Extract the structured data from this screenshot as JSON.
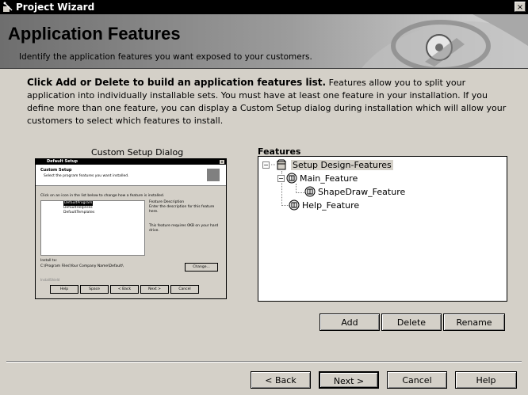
{
  "window": {
    "title": "Project Wizard",
    "close_glyph": "×"
  },
  "banner": {
    "title": "Application Features",
    "subtitle": "Identify the application features you want exposed to your customers."
  },
  "description": {
    "bold": "Click Add or Delete to build an application features list.",
    "text": " Features allow you to split your application into individually installable sets. You must have at least one feature in your installation. If you define more than one feature, you can display a Custom Setup dialog during installation which will allow your customers to select which features to install."
  },
  "custom_setup": {
    "label": "Custom Setup Dialog",
    "preview": {
      "title": "Default Setup",
      "close_glyph": "×",
      "header_title": "Custom Setup",
      "header_sub": "Select the program features you want installed.",
      "instruction": "Click on an icon in the list below to change how a feature is installed.",
      "items": [
        "DefaultProgram",
        "DefaultHelpFiles",
        "DefaultTemplates"
      ],
      "feature_desc_title": "Feature Description",
      "feature_desc": "Enter the description for this feature here.",
      "requires": "This feature requires 0KB on your hard drive.",
      "install_to": "Install to:",
      "path": "C:\\Program Files\\Your Company Name\\Default\\",
      "change": "Change...",
      "brand": "InstallShield",
      "buttons": [
        "Help",
        "Space",
        "< Back",
        "Next >",
        "Cancel"
      ]
    }
  },
  "features": {
    "label": "Features",
    "root": "Setup Design-Features",
    "nodes": [
      {
        "label": "Main_Feature"
      },
      {
        "label": "ShapeDraw_Feature"
      },
      {
        "label": "Help_Feature"
      }
    ],
    "expanders": {
      "collapse": "−"
    }
  },
  "feature_buttons": {
    "add": "Add",
    "delete": "Delete",
    "rename": "Rename"
  },
  "nav_buttons": {
    "back": "< Back",
    "next": "Next >",
    "cancel": "Cancel",
    "help": "Help"
  },
  "icons": {
    "title": "wizard-icon",
    "root": "setup-package-icon",
    "feature": "feature-icon"
  },
  "colors": {
    "dialog_bg": "#d4d0c8",
    "titlebar": "#000000",
    "tree_bg": "#ffffff"
  }
}
